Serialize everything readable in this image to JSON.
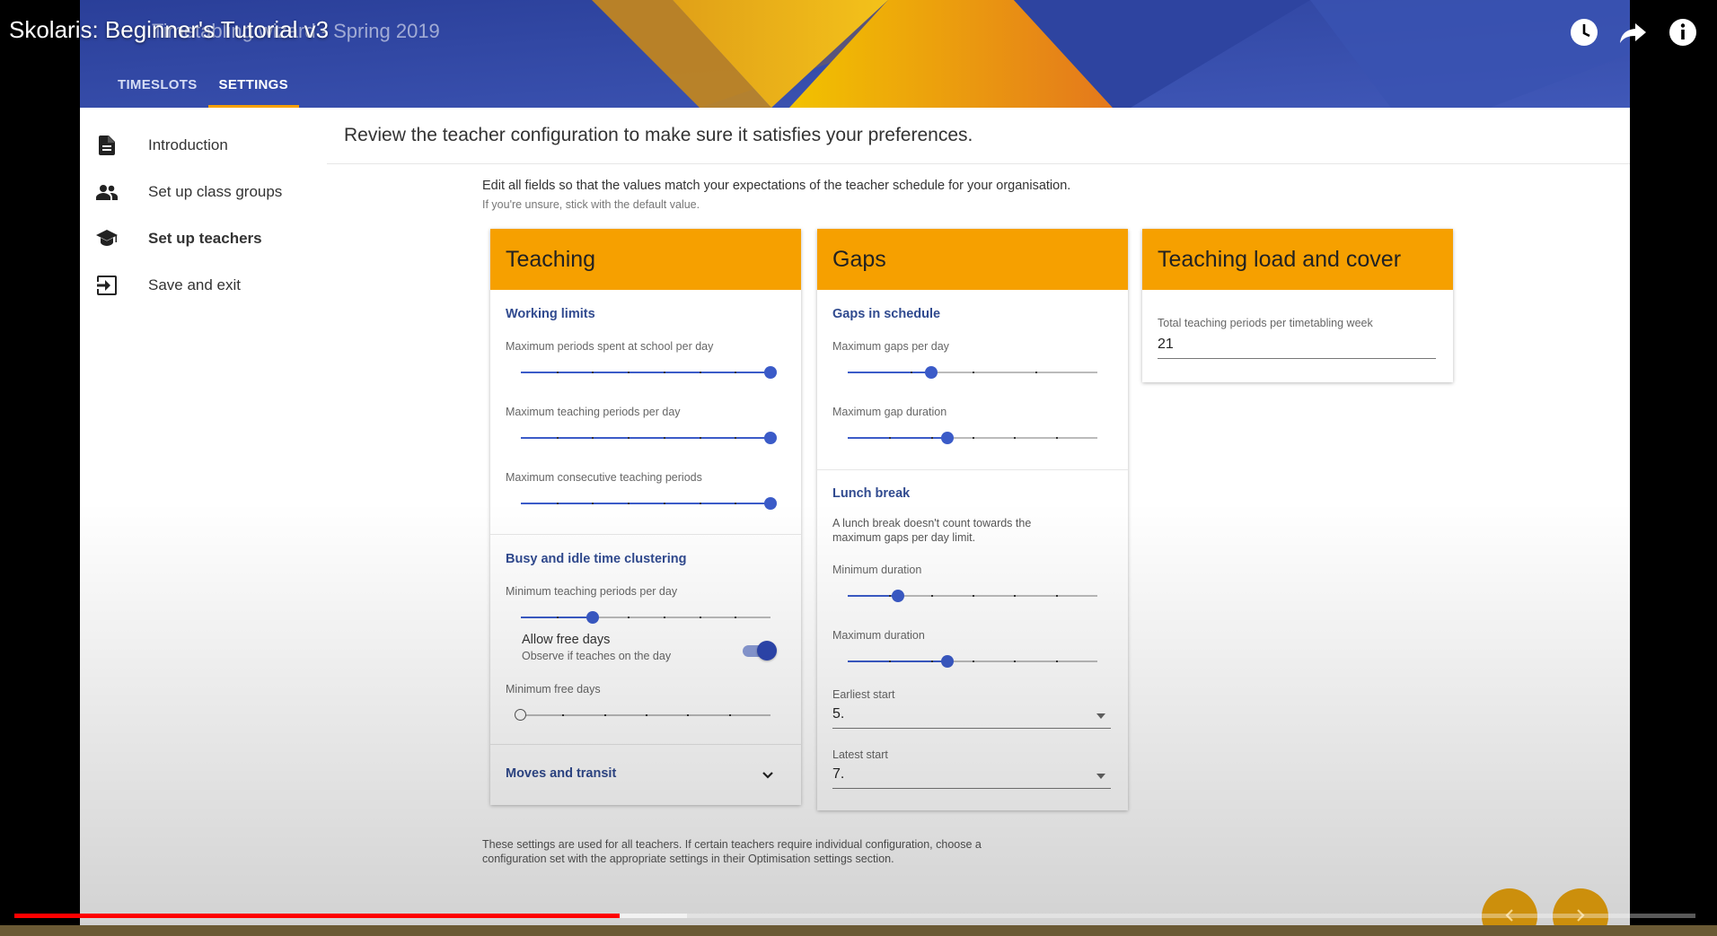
{
  "player": {
    "video_title": "Skolaris: Beginner's Tutorial v3",
    "watch_later_icon": "clock-icon",
    "share_icon": "share-arrow-icon",
    "info_icon": "info-icon",
    "progress_played": 0.36,
    "progress_buffered": 0.4
  },
  "app": {
    "ghost_title": "Timetabling wizard  -  Spring 2019",
    "tabs": [
      {
        "label": "TIMESLOTS",
        "active": false
      },
      {
        "label": "SETTINGS",
        "active": true
      }
    ],
    "colors": {
      "accent": "#f6a000",
      "primary": "#3b5bc8",
      "banner": "#2f4aa6"
    }
  },
  "sidebar": {
    "items": [
      {
        "label": "Introduction",
        "icon": "document-icon",
        "active": false
      },
      {
        "label": "Set up class groups",
        "icon": "people-icon",
        "active": false
      },
      {
        "label": "Set up teachers",
        "icon": "graduation-cap-icon",
        "active": true
      },
      {
        "label": "Save and exit",
        "icon": "exit-icon",
        "active": false
      }
    ]
  },
  "main": {
    "heading": "Review the teacher configuration to make sure it satisfies your preferences.",
    "intro": "Edit all fields so that the values match your expectations of the teacher schedule for your organisation.",
    "intro_hint": "If you're unsure, stick with the default value.",
    "footer": "These settings are used for all teachers. If certain teachers require individual configuration, choose a",
    "footer2": "configuration set with the appropriate settings in their Optimisation settings section."
  },
  "teaching": {
    "title": "Teaching",
    "working_limits": {
      "title": "Working limits",
      "max_school_label": "Maximum periods spent at school per day",
      "max_school_value": 1.0,
      "max_teaching_label": "Maximum teaching periods per day",
      "max_teaching_value": 1.0,
      "max_consecutive_label": "Maximum consecutive teaching periods",
      "max_consecutive_value": 1.0
    },
    "clustering": {
      "title": "Busy and idle time clustering",
      "min_teaching_label": "Minimum teaching periods per day",
      "min_teaching_value": 0.286,
      "allow_free_label": "Allow free days",
      "allow_free_hint": "Observe if teaches on the day",
      "allow_free_on": true,
      "min_free_label": "Minimum free days",
      "min_free_value": 0
    },
    "moves_title": "Moves and transit",
    "moves_icon": "chevron-down-icon"
  },
  "gaps": {
    "title": "Gaps",
    "gaps_in_schedule": {
      "title": "Gaps in schedule",
      "max_gaps_label": "Maximum gaps per day",
      "max_gaps_value": 0.333,
      "max_gap_duration_label": "Maximum gap duration",
      "max_gap_duration_value": 0.4
    },
    "lunch": {
      "title": "Lunch break",
      "desc1": "A lunch break doesn't count towards the",
      "desc2": "maximum gaps per day limit.",
      "min_duration_label": "Minimum duration",
      "min_duration_value": 0.2,
      "max_duration_label": "Maximum duration",
      "max_duration_value": 0.4,
      "earliest_label": "Earliest start",
      "earliest_value": "5.",
      "latest_label": "Latest start",
      "latest_value": "7."
    }
  },
  "load": {
    "title": "Teaching load and cover",
    "total_label": "Total teaching periods per timetabling week",
    "total_value": "21"
  },
  "fabs": {
    "prev_icon": "chevron-left-icon",
    "next_icon": "chevron-right-icon"
  }
}
